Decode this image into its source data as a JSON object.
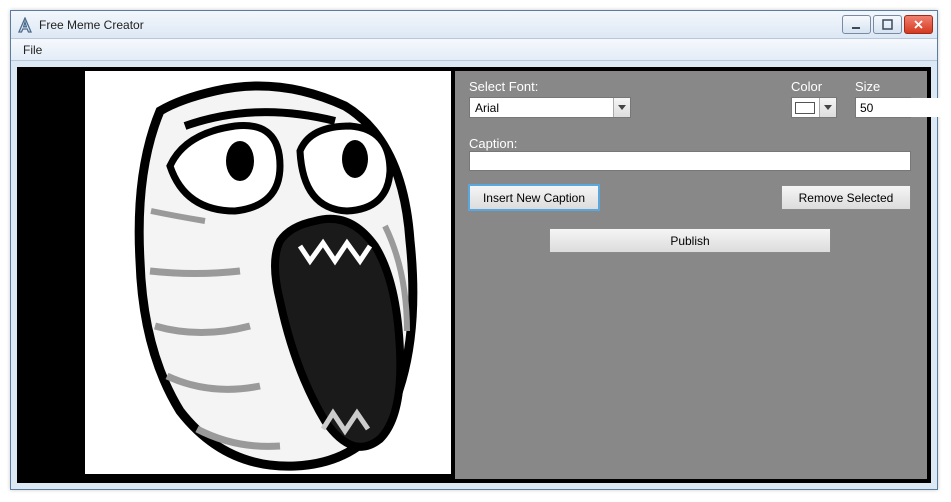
{
  "window": {
    "title": "Free Meme Creator"
  },
  "menu": {
    "file": "File"
  },
  "controls": {
    "font_label": "Select Font:",
    "font_value": "Arial",
    "color_label": "Color",
    "size_label": "Size",
    "size_value": "50",
    "caption_label": "Caption:",
    "caption_value": "",
    "insert_label": "Insert New Caption",
    "remove_label": "Remove Selected",
    "publish_label": "Publish"
  }
}
